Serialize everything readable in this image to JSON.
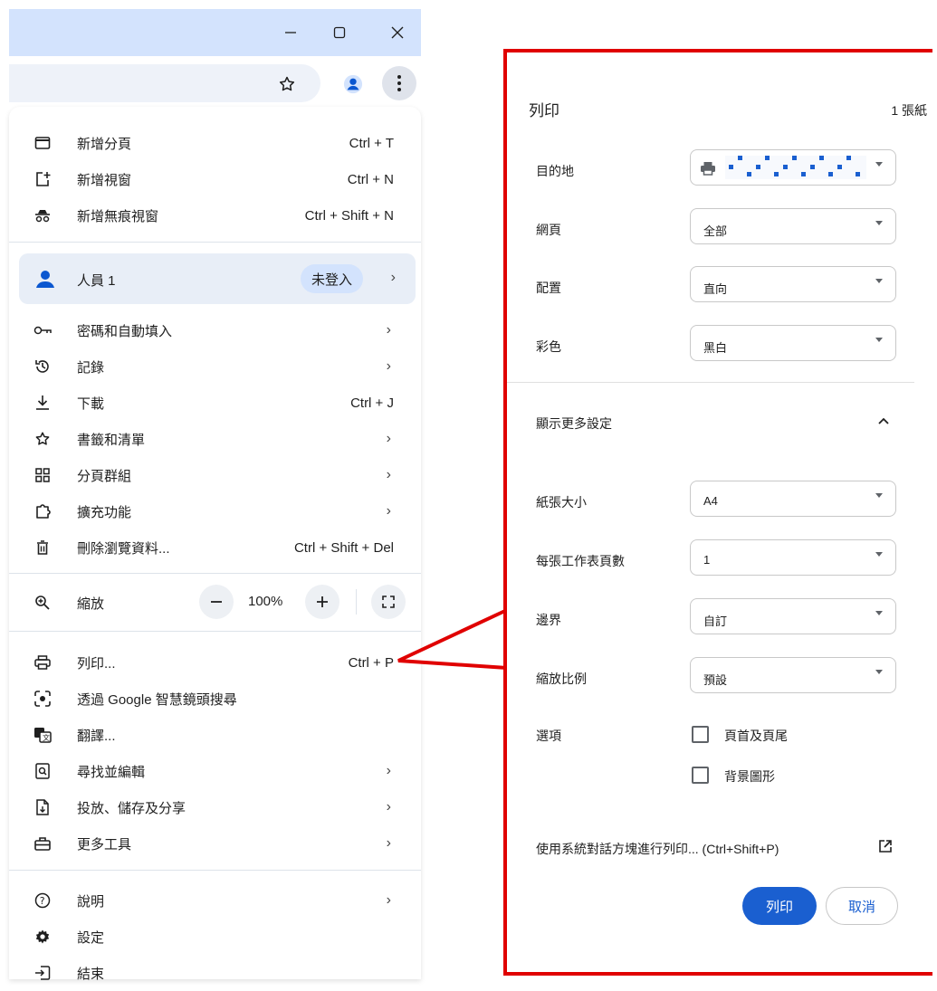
{
  "menu": {
    "new_tab": {
      "label": "新增分頁",
      "shortcut": "Ctrl + T"
    },
    "new_window": {
      "label": "新增視窗",
      "shortcut": "Ctrl + N"
    },
    "incognito": {
      "label": "新增無痕視窗",
      "shortcut": "Ctrl + Shift + N"
    },
    "profile": {
      "name": "人員 1",
      "status": "未登入"
    },
    "passwords": {
      "label": "密碼和自動填入"
    },
    "history": {
      "label": "記錄"
    },
    "downloads": {
      "label": "下載",
      "shortcut": "Ctrl + J"
    },
    "bookmarks": {
      "label": "書籤和清單"
    },
    "tab_groups": {
      "label": "分頁群組"
    },
    "extensions": {
      "label": "擴充功能"
    },
    "clear_data": {
      "label": "刪除瀏覽資料...",
      "shortcut": "Ctrl + Shift + Del"
    },
    "zoom": {
      "label": "縮放",
      "value": "100%"
    },
    "print": {
      "label": "列印...",
      "shortcut": "Ctrl + P"
    },
    "lens": {
      "label": "透過 Google 智慧鏡頭搜尋"
    },
    "translate": {
      "label": "翻譯..."
    },
    "find_edit": {
      "label": "尋找並編輯"
    },
    "cast_save_share": {
      "label": "投放、儲存及分享"
    },
    "more_tools": {
      "label": "更多工具"
    },
    "help": {
      "label": "說明"
    },
    "settings": {
      "label": "設定"
    },
    "exit": {
      "label": "結束"
    }
  },
  "print_dialog": {
    "title": "列印",
    "sheet_count": "1 張紙",
    "destination": {
      "label": "目的地"
    },
    "pages": {
      "label": "網頁",
      "value": "全部"
    },
    "layout": {
      "label": "配置",
      "value": "直向"
    },
    "color": {
      "label": "彩色",
      "value": "黑白"
    },
    "more_settings": "顯示更多設定",
    "paper_size": {
      "label": "紙張大小",
      "value": "A4"
    },
    "pages_per_sheet": {
      "label": "每張工作表頁數",
      "value": "1"
    },
    "margins": {
      "label": "邊界",
      "value": "自訂"
    },
    "scale": {
      "label": "縮放比例",
      "value": "預設"
    },
    "options": {
      "label": "選項",
      "headers_footers": "頁首及頁尾",
      "background_graphics": "背景圖形"
    },
    "system_dialog": "使用系統對話方塊進行列印... (Ctrl+Shift+P)",
    "print_button": "列印",
    "cancel_button": "取消"
  },
  "colors": {
    "highlight": "#e00000",
    "accent": "#1a5fd0",
    "titlebar": "#d3e3fd"
  }
}
